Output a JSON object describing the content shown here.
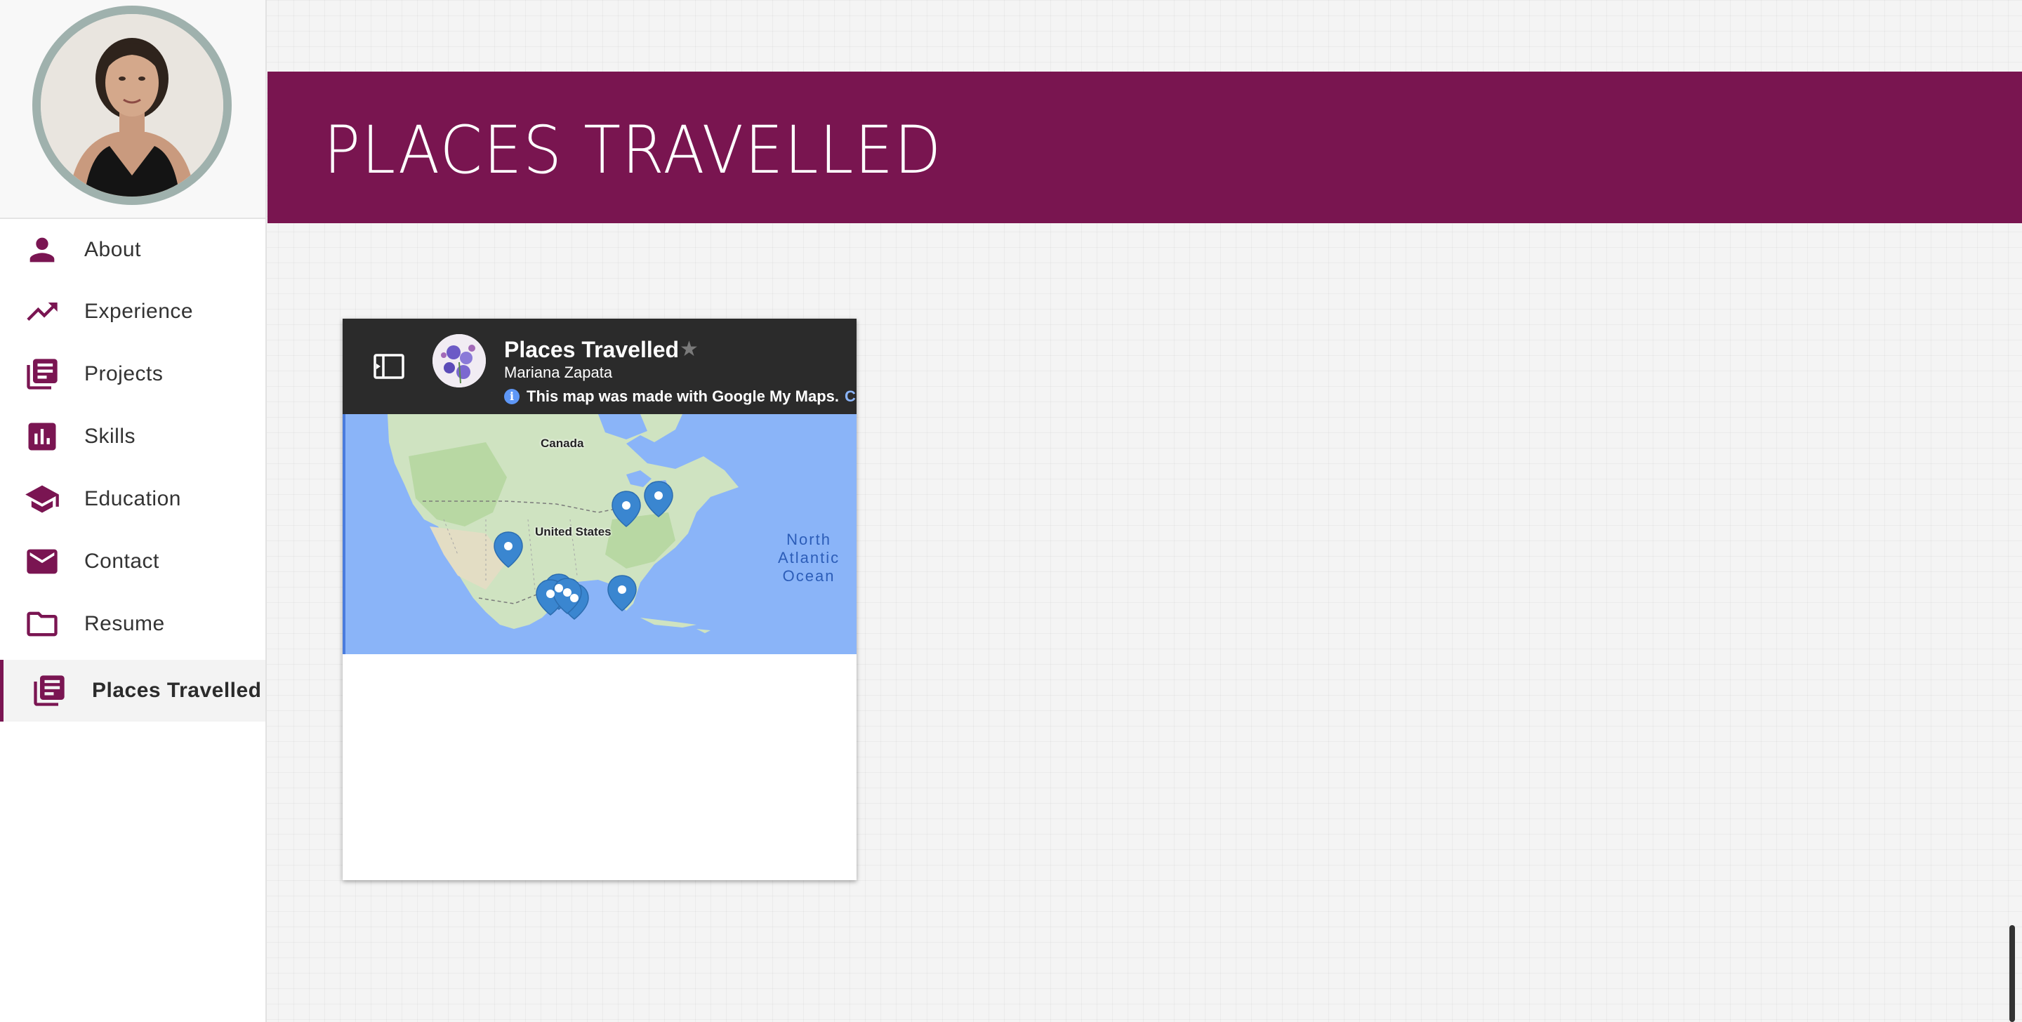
{
  "sidebar": {
    "items": [
      {
        "label": "About",
        "icon": "person-icon"
      },
      {
        "label": "Experience",
        "icon": "trending-up-icon"
      },
      {
        "label": "Projects",
        "icon": "library-books-icon"
      },
      {
        "label": "Skills",
        "icon": "bar-chart-icon"
      },
      {
        "label": "Education",
        "icon": "school-icon"
      },
      {
        "label": "Contact",
        "icon": "mail-icon"
      },
      {
        "label": "Resume",
        "icon": "folder-icon"
      },
      {
        "label": "Places Travelled",
        "icon": "library-books-icon",
        "active": true
      }
    ]
  },
  "header": {
    "title": "PLACES TRAVELLED"
  },
  "map_embed": {
    "title": "Places Travelled",
    "author": "Mariana Zapata",
    "notice": "This map was made with Google My Maps.",
    "notice_link": "Crea",
    "labels": {
      "canada": "Canada",
      "united_states": "United States",
      "ocean": "North Atlantic Ocean"
    },
    "ocean_lines": [
      "North",
      "Atlantic",
      "Ocean"
    ]
  },
  "colors": {
    "accent": "#791550",
    "map_header": "#2b2b2b",
    "marker": "#3a86d0",
    "water": "#8ab4f8"
  }
}
